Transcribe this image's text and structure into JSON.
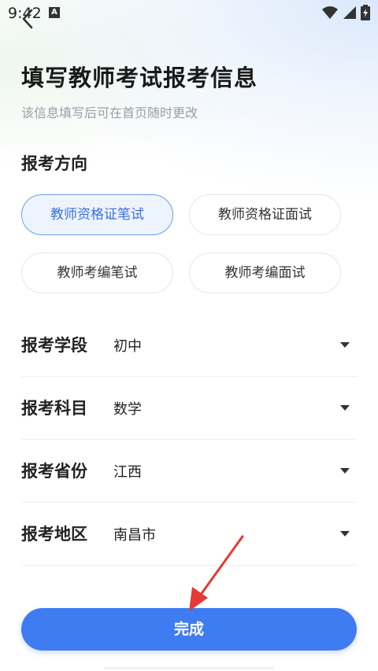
{
  "status_bar": {
    "time": "9:42",
    "notification_letter": "A"
  },
  "header": {
    "title": "填写教师考试报考信息",
    "subtitle": "该信息填写后可在首页随时更改"
  },
  "direction": {
    "section_label": "报考方向",
    "options": [
      {
        "label": "教师资格证笔试",
        "selected": true
      },
      {
        "label": "教师资格证面试",
        "selected": false
      },
      {
        "label": "教师考编笔试",
        "selected": false
      },
      {
        "label": "教师考编面试",
        "selected": false
      }
    ]
  },
  "form": {
    "rows": [
      {
        "label": "报考学段",
        "value": "初中"
      },
      {
        "label": "报考科目",
        "value": "数学"
      },
      {
        "label": "报考省份",
        "value": "江西"
      },
      {
        "label": "报考地区",
        "value": "南昌市"
      }
    ]
  },
  "submit": {
    "label": "完成"
  },
  "colors": {
    "accent": "#3f7cf2",
    "selected_bg": "#eef4fe",
    "annotation": "#e53935"
  }
}
